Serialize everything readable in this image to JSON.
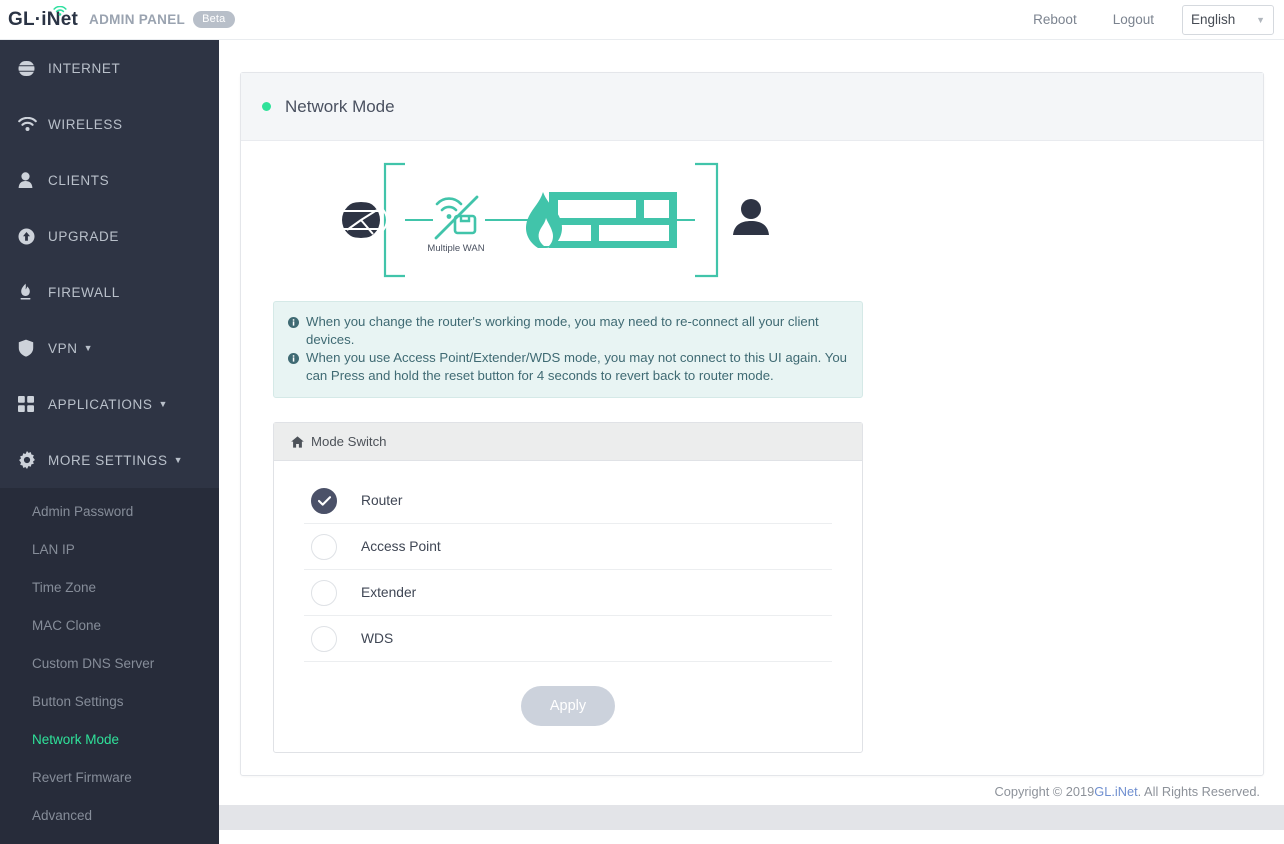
{
  "header": {
    "logo_text": "GL·iNet",
    "logo_icon": "wifi-arc-icon",
    "subtitle": "ADMIN PANEL",
    "badge": "Beta",
    "reboot_label": "Reboot",
    "logout_label": "Logout",
    "language_value": "English",
    "language_caret_icon": "chevron-down-icon"
  },
  "sidebar": {
    "items": [
      {
        "label": "INTERNET",
        "icon": "globe-icon",
        "caret": false
      },
      {
        "label": "WIRELESS",
        "icon": "wifi-icon",
        "caret": false
      },
      {
        "label": "CLIENTS",
        "icon": "user-icon",
        "caret": false
      },
      {
        "label": "UPGRADE",
        "icon": "upload-circle-icon",
        "caret": false
      },
      {
        "label": "FIREWALL",
        "icon": "flame-icon",
        "caret": false
      },
      {
        "label": "VPN",
        "icon": "shield-icon",
        "caret": true
      },
      {
        "label": "APPLICATIONS",
        "icon": "grid-icon",
        "caret": true
      },
      {
        "label": "MORE SETTINGS",
        "icon": "gear-icon",
        "caret": true
      }
    ],
    "submenu": [
      {
        "label": "Admin Password",
        "active": false
      },
      {
        "label": "LAN IP",
        "active": false
      },
      {
        "label": "Time Zone",
        "active": false
      },
      {
        "label": "MAC Clone",
        "active": false
      },
      {
        "label": "Custom DNS Server",
        "active": false
      },
      {
        "label": "Button Settings",
        "active": false
      },
      {
        "label": "Network Mode",
        "active": true
      },
      {
        "label": "Revert Firmware",
        "active": false
      },
      {
        "label": "Advanced",
        "active": false
      }
    ]
  },
  "panel": {
    "title": "Network Mode",
    "status_dot_color": "#2fe29a"
  },
  "diagram": {
    "internet_icon": "globe-icon",
    "wan_icon": "multiple-wan-icon",
    "wan_label": "Multiple WAN",
    "firewall_icon": "firewall-brickwall-flame-icon",
    "client_icon": "user-icon",
    "accent_color": "#41c4aa",
    "dark_color": "#2e3444"
  },
  "notice": {
    "icon": "info-circle-icon",
    "line1": "When you change the router's working mode, you may need to re-connect all your client devices.",
    "line2": "When you use Access Point/Extender/WDS mode, you may not connect to this UI again. You can Press and hold the reset button for 4 seconds to revert back to router mode."
  },
  "mode_switch": {
    "header_icon": "home-icon",
    "header_label": "Mode Switch",
    "options": [
      {
        "label": "Router",
        "selected": true
      },
      {
        "label": "Access Point",
        "selected": false
      },
      {
        "label": "Extender",
        "selected": false
      },
      {
        "label": "WDS",
        "selected": false
      }
    ],
    "apply_label": "Apply",
    "apply_disabled": true
  },
  "footer": {
    "prefix": "Copyright © 2019 ",
    "link": "GL.iNet",
    "suffix": ". All Rights Reserved."
  }
}
